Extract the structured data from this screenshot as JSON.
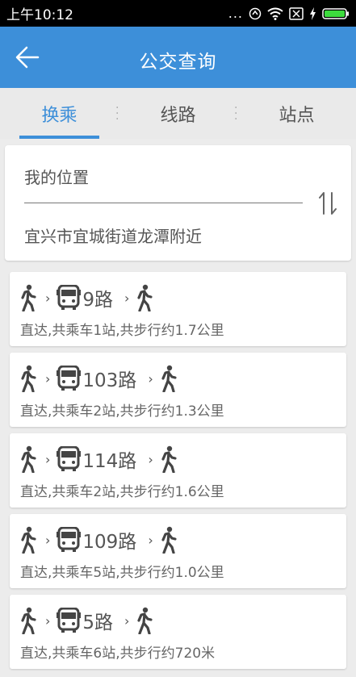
{
  "status_bar": {
    "time": "上午10:12",
    "dots": "..."
  },
  "app_bar": {
    "title": "公交查询"
  },
  "tabs": [
    {
      "label": "换乘",
      "active": true
    },
    {
      "label": "线路",
      "active": false
    },
    {
      "label": "站点",
      "active": false
    }
  ],
  "location": {
    "from": "我的位置",
    "to": "宜兴市宜城街道龙潭附近"
  },
  "routes": [
    {
      "name": "9路",
      "desc": "直达,共乘车1站,共步行约1.7公里"
    },
    {
      "name": "103路",
      "desc": "直达,共乘车2站,共步行约1.3公里"
    },
    {
      "name": "114路",
      "desc": "直达,共乘车2站,共步行约1.6公里"
    },
    {
      "name": "109路",
      "desc": "直达,共乘车5站,共步行约1.0公里"
    },
    {
      "name": "5路",
      "desc": "直达,共乘车6站,共步行约720米"
    }
  ],
  "colors": {
    "primary": "#3d8fd9",
    "background": "#ececec",
    "text": "#555555"
  }
}
